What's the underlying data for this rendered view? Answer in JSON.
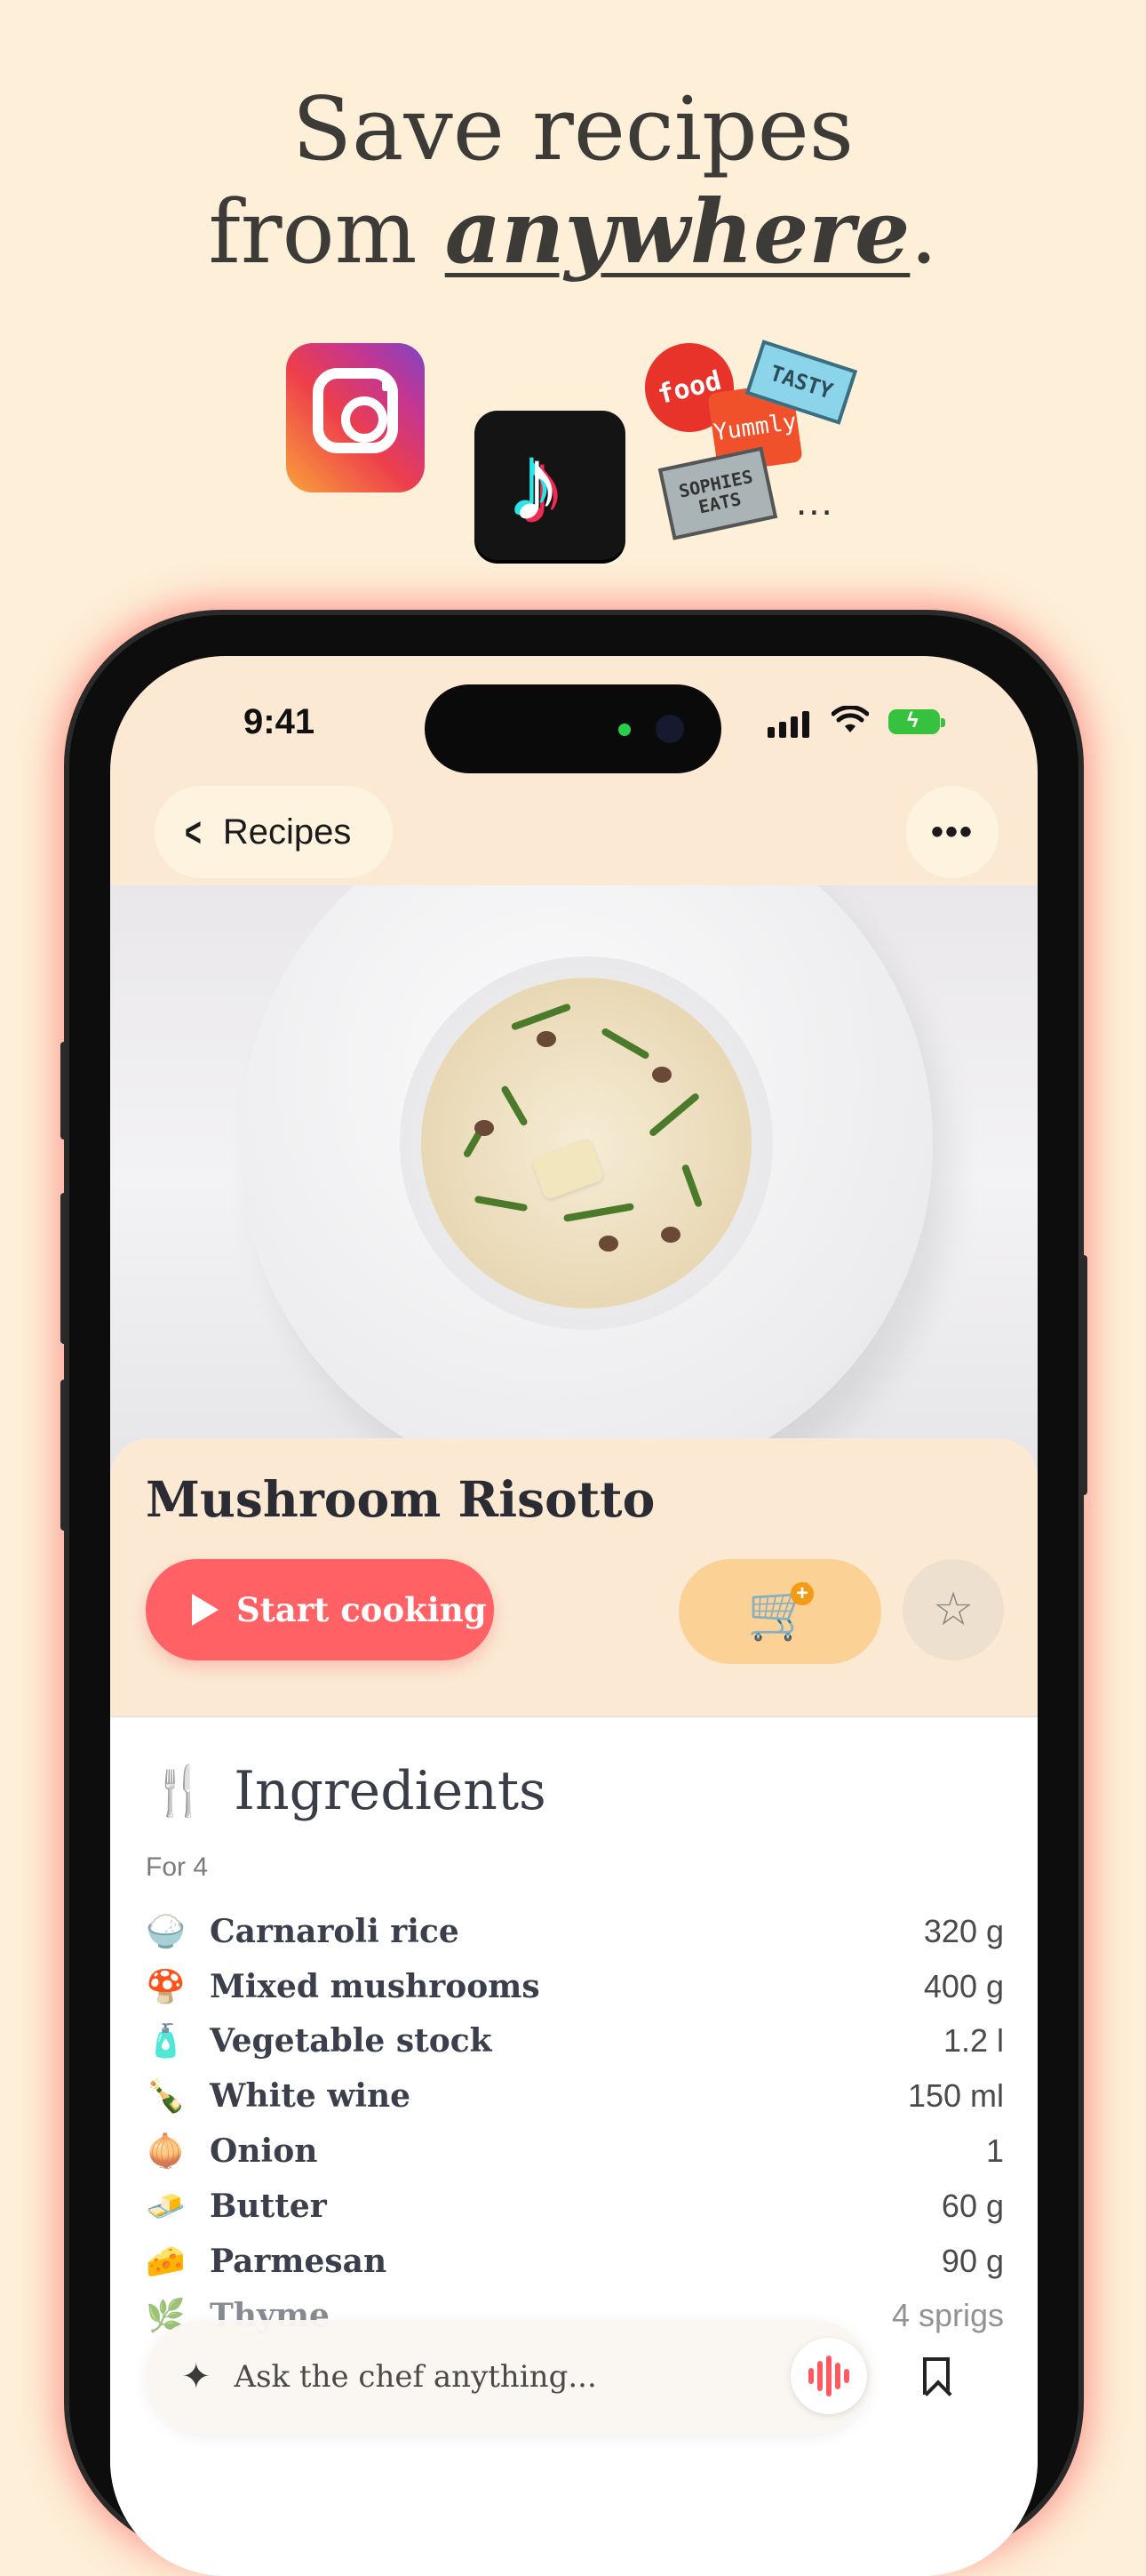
{
  "headline": {
    "line1": "Save recipes",
    "line2_prefix": "from ",
    "line2_emph": "anywhere",
    "line2_suffix": "."
  },
  "sources": {
    "tiktok_glyph": "♪",
    "food_badge": "food",
    "tasty_badge": "TASTY",
    "yummly_badge": "Yummly",
    "sophies_badge": "SOPHIES EATS",
    "more": "..."
  },
  "status_bar": {
    "time": "9:41"
  },
  "nav": {
    "back_label": "Recipes",
    "back_glyph": "<",
    "more_glyph": "•••"
  },
  "recipe": {
    "title": "Mushroom Risotto",
    "start_label": "Start cooking",
    "star_glyph": "☆",
    "cart_glyph": "🛒",
    "cart_plus": "+"
  },
  "ingredients": {
    "heading": "Ingredients",
    "heading_glyph": "🍴",
    "serves": "For 4",
    "items": [
      {
        "icon": "🍚",
        "name": "Carnaroli rice",
        "qty": "320 g"
      },
      {
        "icon": "🍄",
        "name": "Mixed mushrooms",
        "qty": "400 g"
      },
      {
        "icon": "🧴",
        "name": "Vegetable stock",
        "qty": "1.2 l"
      },
      {
        "icon": "🍾",
        "name": "White wine",
        "qty": "150 ml"
      },
      {
        "icon": "🧅",
        "name": "Onion",
        "qty": "1"
      },
      {
        "icon": "🧈",
        "name": "Butter",
        "qty": "60 g"
      },
      {
        "icon": "🧀",
        "name": "Parmesan",
        "qty": "90 g"
      },
      {
        "icon": "🌿",
        "name": "Thyme",
        "qty": "4 sprigs"
      }
    ]
  },
  "chat": {
    "placeholder": "Ask the chef anything...",
    "spark_glyph": "✦"
  },
  "colors": {
    "background": "#fdefd8",
    "accent_red": "#ff6165",
    "accent_orange": "#f39a16"
  }
}
